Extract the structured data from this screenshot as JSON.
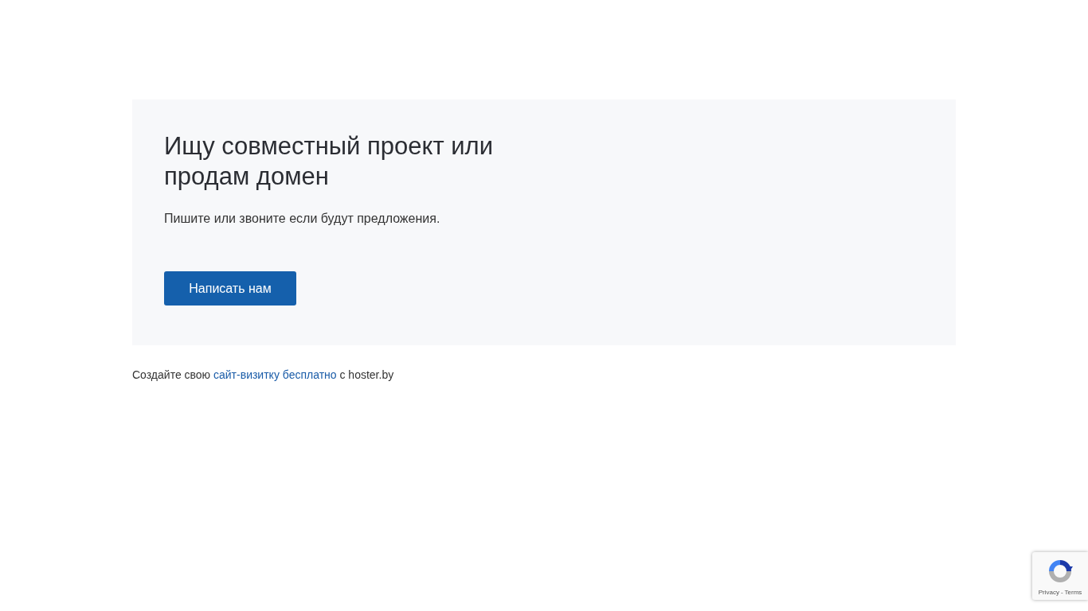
{
  "card": {
    "title": "Ищу совместный проект или продам домен",
    "text": "Пишите или звоните если будут предложения.",
    "button": "Написать нам"
  },
  "footer": {
    "before": "Создайте свою ",
    "link": "сайт-визитку бесплатно",
    "after": " с hoster.by"
  },
  "recaptcha": {
    "privacy": "Privacy",
    "separator": "-",
    "terms": "Terms"
  }
}
